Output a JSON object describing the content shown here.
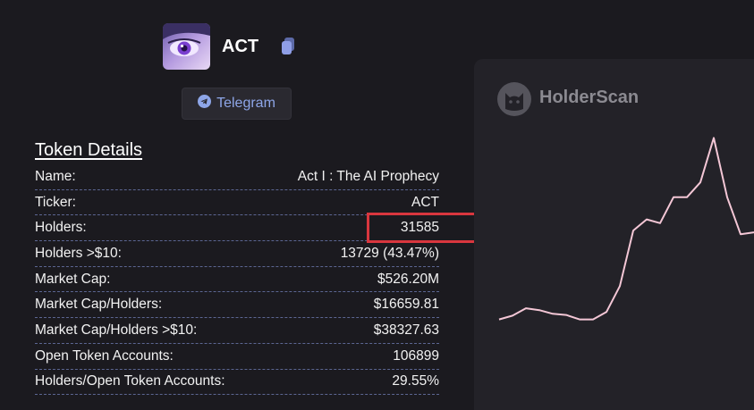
{
  "token": {
    "symbol": "ACT",
    "copy_icon": "copy-icon",
    "telegram_label": "Telegram",
    "telegram_icon": "telegram-icon"
  },
  "details": {
    "title": "Token Details",
    "rows": [
      {
        "label": "Name:",
        "value": "Act I : The AI Prophecy"
      },
      {
        "label": "Ticker:",
        "value": "ACT"
      },
      {
        "label": "Holders:",
        "value": "31585"
      },
      {
        "label": "Holders >$10:",
        "value": "13729 (43.47%)"
      },
      {
        "label": "Market Cap:",
        "value": "$526.20M"
      },
      {
        "label": "Market Cap/Holders:",
        "value": "$16659.81"
      },
      {
        "label": "Market Cap/Holders >$10:",
        "value": "$38327.63"
      },
      {
        "label": "Open Token Accounts:",
        "value": "106899"
      },
      {
        "label": "Holders/Open Token Accounts:",
        "value": "29.55%"
      }
    ]
  },
  "panel": {
    "brand": "HolderScan",
    "brand_icon": "cat-logo-icon",
    "line_color": "#f4c7d6"
  },
  "chart_data": {
    "type": "line",
    "series": [
      {
        "values": [
          3,
          4,
          6,
          5.5,
          4.5,
          4.2,
          3,
          3,
          5,
          12,
          27,
          30,
          29,
          36,
          36,
          40,
          52,
          36,
          26,
          26.5
        ]
      }
    ],
    "ylim": [
      0,
      55
    ]
  }
}
